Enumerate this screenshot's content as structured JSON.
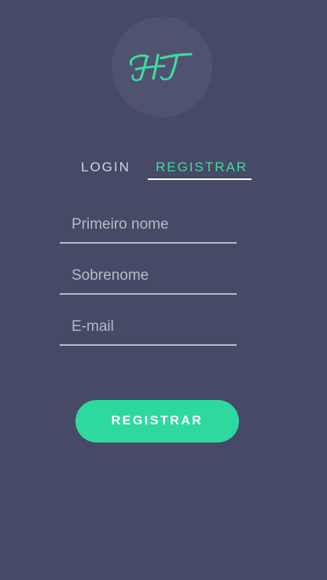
{
  "logo": {
    "text": "HT",
    "color": "#3ddba0"
  },
  "tabs": [
    {
      "label": "LOGIN",
      "active": false
    },
    {
      "label": "REGISTRAR",
      "active": true
    }
  ],
  "form": {
    "first_name": {
      "value": "",
      "placeholder": "Primeiro nome"
    },
    "last_name": {
      "value": "",
      "placeholder": "Sobrenome"
    },
    "email": {
      "value": "",
      "placeholder": "E-mail"
    },
    "submit_label": "REGISTRAR"
  },
  "colors": {
    "background": "#474a66",
    "accent": "#2ed9a0"
  }
}
